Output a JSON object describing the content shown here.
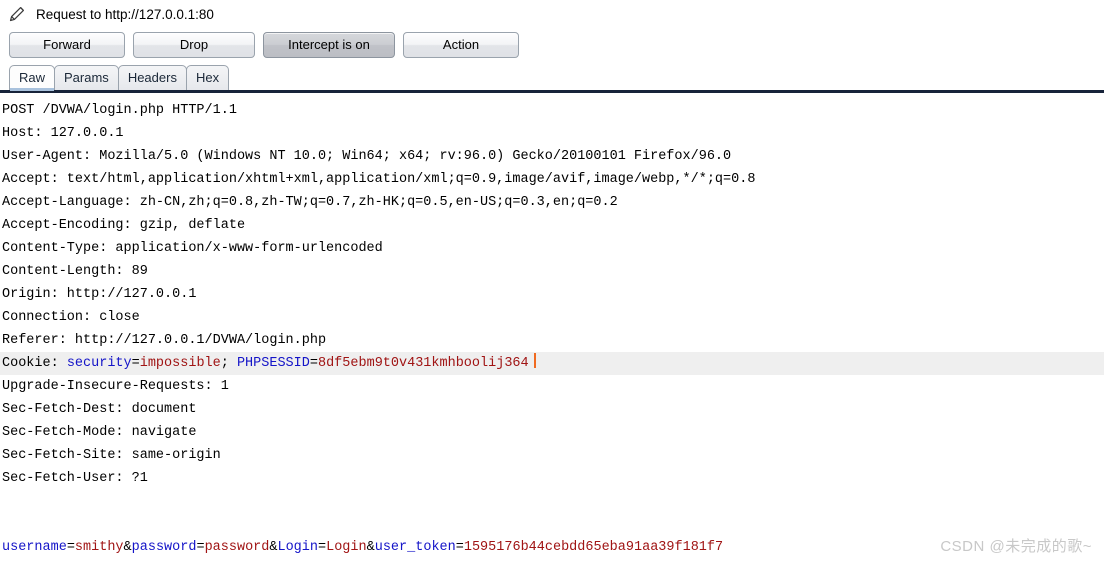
{
  "window": {
    "title": "Request to http://127.0.0.1:80",
    "edit_icon": "pencil-icon"
  },
  "toolbar": {
    "forward_label": "Forward",
    "drop_label": "Drop",
    "intercept_label": "Intercept is on",
    "action_label": "Action"
  },
  "tabs": [
    {
      "label": "Raw",
      "active": true
    },
    {
      "label": "Params",
      "active": false
    },
    {
      "label": "Headers",
      "active": false
    },
    {
      "label": "Hex",
      "active": false
    }
  ],
  "request": {
    "lines": [
      {
        "text": "POST /DVWA/login.php HTTP/1.1"
      },
      {
        "text": "Host: 127.0.0.1"
      },
      {
        "text": "User-Agent: Mozilla/5.0 (Windows NT 10.0; Win64; x64; rv:96.0) Gecko/20100101 Firefox/96.0"
      },
      {
        "text": "Accept: text/html,application/xhtml+xml,application/xml;q=0.9,image/avif,image/webp,*/*;q=0.8"
      },
      {
        "text": "Accept-Language: zh-CN,zh;q=0.8,zh-TW;q=0.7,zh-HK;q=0.5,en-US;q=0.3,en;q=0.2"
      },
      {
        "text": "Accept-Encoding: gzip, deflate"
      },
      {
        "text": "Content-Type: application/x-www-form-urlencoded"
      },
      {
        "text": "Content-Length: 89"
      },
      {
        "text": "Origin: http://127.0.0.1"
      },
      {
        "text": "Connection: close"
      },
      {
        "text": "Referer: http://127.0.0.1/DVWA/login.php"
      }
    ],
    "cookie_line": {
      "prefix": "Cookie: ",
      "parts": [
        {
          "key": "security",
          "eq": "=",
          "value": "impossible"
        },
        {
          "sep": "; "
        },
        {
          "key": "PHPSESSID",
          "eq": "=",
          "value": "8df5ebm9t0v431kmhboolij364"
        }
      ]
    },
    "lines_after": [
      {
        "text": "Upgrade-Insecure-Requests: 1"
      },
      {
        "text": "Sec-Fetch-Dest: document"
      },
      {
        "text": "Sec-Fetch-Mode: navigate"
      },
      {
        "text": "Sec-Fetch-Site: same-origin"
      },
      {
        "text": "Sec-Fetch-User: ?1"
      }
    ],
    "body": {
      "params": [
        {
          "key": "username",
          "eq": "=",
          "value": "smithy"
        },
        {
          "amp": "&"
        },
        {
          "key": "password",
          "eq": "=",
          "value": "password"
        },
        {
          "amp": "&"
        },
        {
          "key": "Login",
          "eq": "=",
          "value": "Login"
        },
        {
          "amp": "&"
        },
        {
          "key": "user_token",
          "eq": "=",
          "value": "1595176b44cebdd65eba91aa39f181f7"
        }
      ]
    }
  },
  "watermark": {
    "text": "CSDN @未完成的歌~"
  },
  "colors": {
    "separator": "#17233a",
    "param_key": "#1414c8",
    "param_value": "#a01414",
    "highlight": "#efefef",
    "caret": "#f06a20",
    "tab_underline": "#a9c2dd"
  }
}
